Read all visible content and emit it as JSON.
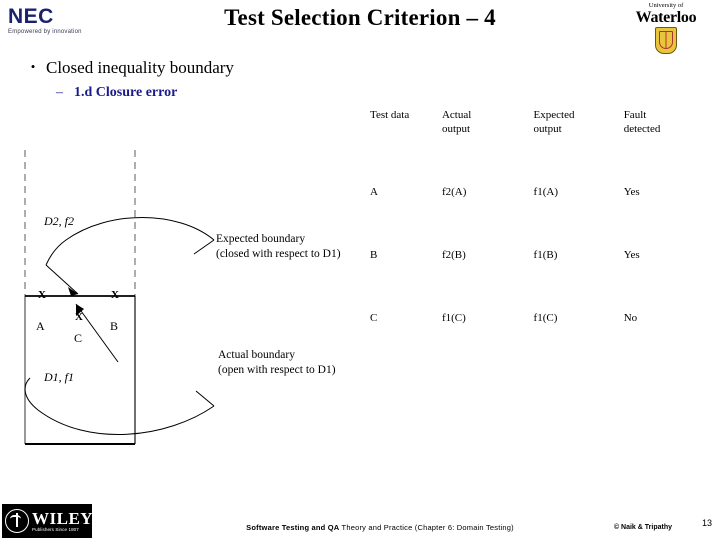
{
  "slide": {
    "title": "Test Selection Criterion – 4",
    "bullets": {
      "level1_marker": "•",
      "level1": "Closed inequality boundary",
      "level2_marker": "–",
      "level2": "1.d Closure error"
    }
  },
  "logos": {
    "nec": {
      "wordmark": "NEC",
      "tagline": "Empowered by innovation"
    },
    "waterloo": {
      "line1": "University of",
      "line2": "Waterloo"
    },
    "wiley": {
      "word": "WILEY",
      "tagline": "Publishers Since 1807"
    }
  },
  "diagram": {
    "region_upper_label": "D2, f2",
    "region_lower_label": "D1, f1",
    "point_a": "A",
    "point_b": "B",
    "point_c": "C",
    "marker": "X",
    "annotation_expected_line1": "Expected boundary",
    "annotation_expected_line2": "(closed with respect to D1)",
    "annotation_actual_line1": "Actual boundary",
    "annotation_actual_line2": "(open with respect to D1)"
  },
  "table": {
    "headers": [
      "Test data",
      "Actual\noutput",
      "Expected\noutput",
      "Fault\ndetected"
    ],
    "headers_split": [
      {
        "l1": "Test data",
        "l2": ""
      },
      {
        "l1": "Actual",
        "l2": "output"
      },
      {
        "l1": "Expected",
        "l2": "output"
      },
      {
        "l1": "Fault",
        "l2": "detected"
      }
    ],
    "rows": [
      {
        "test_data": "A",
        "actual_output": "f2(A)",
        "expected_output": "f1(A)",
        "fault_detected": "Yes"
      },
      {
        "test_data": "B",
        "actual_output": "f2(B)",
        "expected_output": "f1(B)",
        "fault_detected": "Yes"
      },
      {
        "test_data": "C",
        "actual_output": "f1(C)",
        "expected_output": "f1(C)",
        "fault_detected": "No"
      }
    ]
  },
  "footer": {
    "book_bold": "Software Testing and QA",
    "book_rest": " Theory and Practice (Chapter 6: Domain Testing)",
    "copyright": "© Naik & Tripathy",
    "page_number": "13"
  },
  "colors": {
    "nec_blue": "#1a2270",
    "subtitle_blue": "#1a1a8c",
    "waterloo_gold": "#e8c53c",
    "ink": "#000000"
  }
}
